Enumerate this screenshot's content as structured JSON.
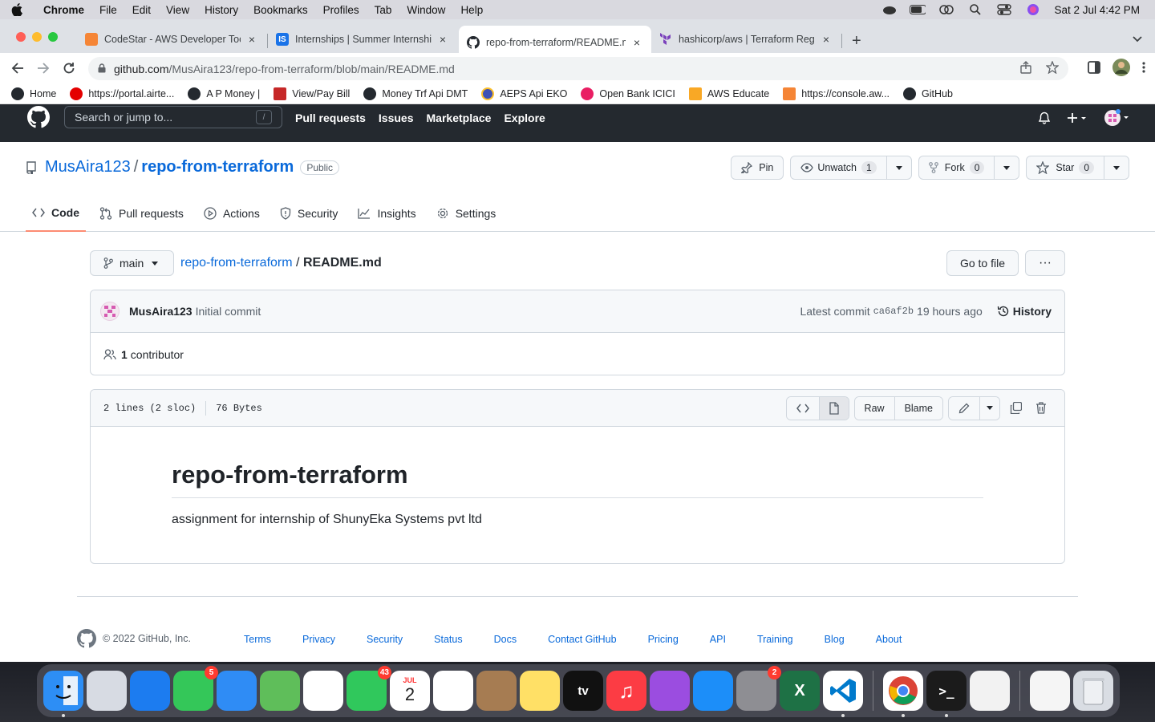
{
  "menubar": {
    "app": "Chrome",
    "items": [
      "File",
      "Edit",
      "View",
      "History",
      "Bookmarks",
      "Profiles",
      "Tab",
      "Window",
      "Help"
    ],
    "datetime": "Sat 2 Jul  4:42 PM"
  },
  "tabs": [
    {
      "title": "CodeStar - AWS Developer Tools",
      "close": "×",
      "fav_color": "#f58536"
    },
    {
      "title": "Internships | Summer Internships",
      "close": "×",
      "fav_color": "#1a73e8"
    },
    {
      "title": "repo-from-terraform/README.md",
      "close": "×",
      "fav_color": "#24292f"
    },
    {
      "title": "hashicorp/aws | Terraform Registry",
      "close": "×",
      "fav_color": "#7b42bc"
    }
  ],
  "omnibox": {
    "host": "github.com",
    "path": "/MusAira123/repo-from-terraform/blob/main/README.md"
  },
  "bookmarks": [
    {
      "label": "Home",
      "color": "#24292f"
    },
    {
      "label": "https://portal.airte...",
      "color": "#e40000"
    },
    {
      "label": "A P Money |",
      "color": "#24292f"
    },
    {
      "label": "View/Pay Bill",
      "color": "#c62828"
    },
    {
      "label": "Money Trf Api DMT",
      "color": "#24292f"
    },
    {
      "label": "AEPS Api EKO",
      "color": "#3f51b5"
    },
    {
      "label": "Open Bank ICICI",
      "color": "#e91e63"
    },
    {
      "label": "AWS Educate",
      "color": "#f9a825"
    },
    {
      "label": "https://console.aw...",
      "color": "#f58536"
    },
    {
      "label": "GitHub",
      "color": "#24292f"
    }
  ],
  "github": {
    "search_placeholder": "Search or jump to...",
    "search_key": "/",
    "nav": [
      "Pull requests",
      "Issues",
      "Marketplace",
      "Explore"
    ],
    "repo": {
      "owner": "MusAira123",
      "separator": "/",
      "name": "repo-from-terraform",
      "visibility": "Public",
      "pin": "Pin",
      "unwatch": "Unwatch",
      "watch_count": "1",
      "fork": "Fork",
      "fork_count": "0",
      "star": "Star",
      "star_count": "0"
    },
    "repo_tabs": [
      "Code",
      "Pull requests",
      "Actions",
      "Security",
      "Insights",
      "Settings"
    ],
    "branch": "main",
    "breadcrumb_repo": "repo-from-terraform",
    "breadcrumb_sep": "/",
    "breadcrumb_file": "README.md",
    "goto_file": "Go to file",
    "more": "···",
    "commit": {
      "author": "MusAira123",
      "message": "Initial commit",
      "latest_label": "Latest commit",
      "sha": "ca6af2b",
      "time": "19 hours ago",
      "history": "History"
    },
    "contributors": {
      "count": "1",
      "label": "contributor"
    },
    "file": {
      "lines": "2 lines (2 sloc)",
      "size": "76 Bytes",
      "raw": "Raw",
      "blame": "Blame"
    },
    "readme": {
      "title": "repo-from-terraform",
      "body": "assignment for internship of ShunyEka Systems pvt ltd"
    },
    "footer": {
      "copyright": "© 2022 GitHub, Inc.",
      "links": [
        "Terms",
        "Privacy",
        "Security",
        "Status",
        "Docs",
        "Contact GitHub",
        "Pricing",
        "API",
        "Training",
        "Blog",
        "About"
      ]
    }
  },
  "dock": [
    {
      "name": "finder",
      "color": "#2d8ef5",
      "running": true
    },
    {
      "name": "launchpad",
      "color": "#d7dbe3"
    },
    {
      "name": "safari",
      "color": "#1c7cf0"
    },
    {
      "name": "messages",
      "color": "#34c759",
      "badge": "5"
    },
    {
      "name": "mail",
      "color": "#2f8cf5"
    },
    {
      "name": "maps",
      "color": "#5fbe5a"
    },
    {
      "name": "photos",
      "color": "#ffffff"
    },
    {
      "name": "facetime",
      "color": "#30c85c",
      "badge": "43"
    },
    {
      "name": "calendar",
      "color": "#ffffff",
      "month": "JUL",
      "day": "2"
    },
    {
      "name": "reminders",
      "color": "#ffffff"
    },
    {
      "name": "contacts",
      "color": "#a67c52"
    },
    {
      "name": "notes",
      "color": "#ffe066"
    },
    {
      "name": "tv",
      "color": "#111111",
      "label": "tv"
    },
    {
      "name": "music",
      "color": "#fc3c44"
    },
    {
      "name": "podcasts",
      "color": "#9b4de0"
    },
    {
      "name": "app-store",
      "color": "#1c8ef9"
    },
    {
      "name": "system-preferences",
      "color": "#8e8e93",
      "badge": "2"
    },
    {
      "name": "excel",
      "color": "#1e7145"
    },
    {
      "name": "vscode",
      "color": "#ffffff",
      "running": true
    },
    {
      "name": "chrome",
      "color": "#ffffff",
      "running": true
    },
    {
      "name": "terminal",
      "color": "#1b1b1b",
      "running": true
    },
    {
      "name": "archive",
      "color": "#f2f2f2"
    },
    {
      "name": "csv-file",
      "color": "#f5f5f5"
    },
    {
      "name": "trash",
      "color": "#d9dde3"
    }
  ]
}
